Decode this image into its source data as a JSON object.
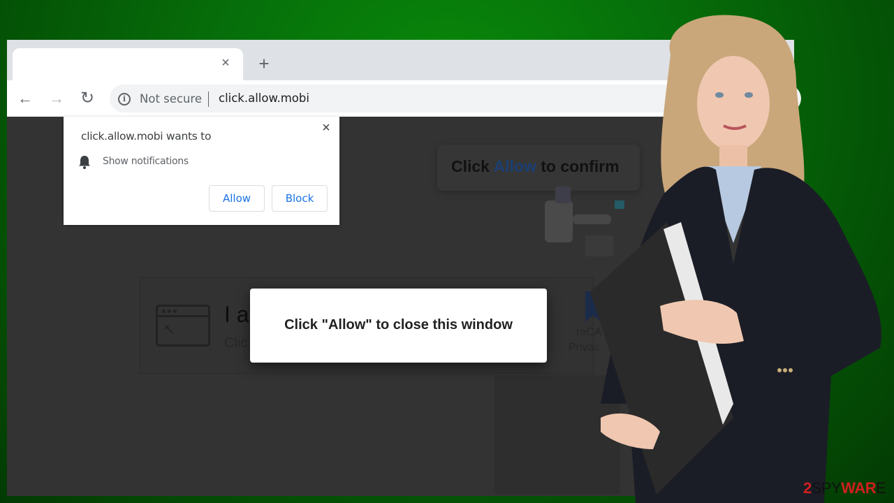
{
  "browser": {
    "tab": {
      "title": "",
      "close_icon": "×"
    },
    "new_tab_icon": "+",
    "nav": {
      "back_icon": "←",
      "forward_icon": "→",
      "reload_icon": "↻"
    },
    "address_bar": {
      "security_label": "Not secure",
      "info_icon": "i",
      "url": "click.allow.mobi"
    }
  },
  "permission_prompt": {
    "title": "click.allow.mobi wants to",
    "permission": "Show notifications",
    "close_icon": "×",
    "allow_label": "Allow",
    "block_label": "Block",
    "accent_color": "#1a73e8"
  },
  "page": {
    "confirm_prefix": "Click ",
    "confirm_accent": "Allow",
    "confirm_suffix": " to confirm",
    "human_title": "I a",
    "human_subtitle": "Clic",
    "recaptcha_label": "reCA",
    "recaptcha_privacy": "Privac"
  },
  "modal": {
    "text": "Click \"Allow\" to close this window"
  },
  "watermark": {
    "part1": "2",
    "part2": "SPY",
    "part3": "WAR",
    "part4": "E"
  },
  "colors": {
    "background_green": "#0a8a0a",
    "page_dim": "#333333",
    "watermark_red": "#d01f1f"
  }
}
